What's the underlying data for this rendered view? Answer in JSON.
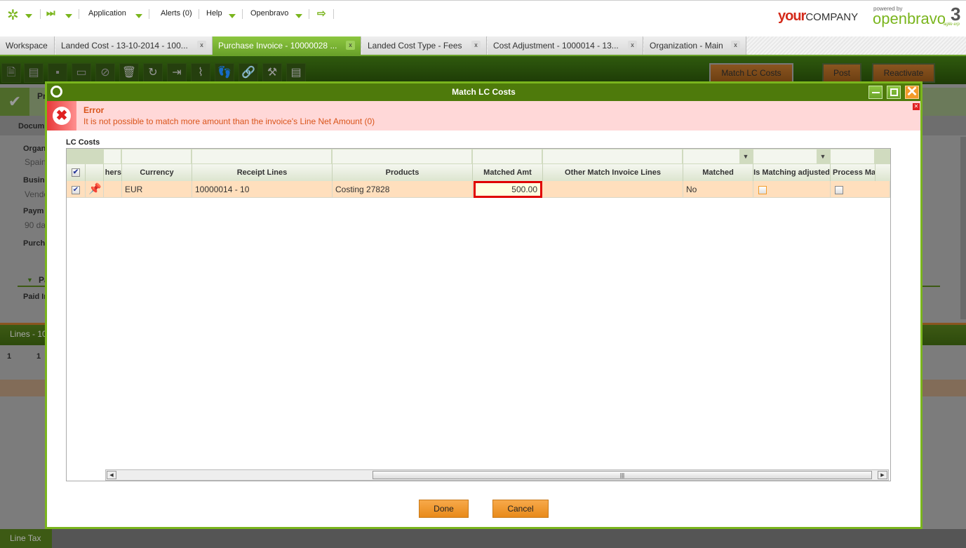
{
  "topnav": {
    "items": [
      "Application",
      "Alerts (0)",
      "Help",
      "Openbravo"
    ],
    "logo_your": "your",
    "logo_company": "COMPANY",
    "powered_by": "powered by",
    "brand": "openbravo",
    "brand_tag": "agile erp"
  },
  "tabs": [
    {
      "label": "Workspace",
      "closable": false
    },
    {
      "label": "Landed Cost - 13-10-2014 - 100...",
      "closable": true
    },
    {
      "label": "Purchase Invoice - 10000028 ...",
      "closable": true,
      "active": true
    },
    {
      "label": "Landed Cost Type - Fees",
      "closable": true
    },
    {
      "label": "Cost Adjustment - 1000014 - 13...",
      "closable": true
    },
    {
      "label": "Organization - Main",
      "closable": true
    }
  ],
  "toolbar": {
    "match_lc_costs": "Match LC Costs",
    "post": "Post",
    "reactivate": "Reactivate"
  },
  "background": {
    "status_short": "Pr",
    "section": "Docum",
    "fields": [
      {
        "label": "Organ",
        "value": "Spain"
      },
      {
        "label": "Busin",
        "value": "Vendo"
      },
      {
        "label": "Paym",
        "value": "90 da"
      },
      {
        "label": "Purch",
        "value": ""
      }
    ],
    "group": "Pa",
    "paid_label": "Paid In",
    "lines_tab": "Lines - 10",
    "line_tax_tab": "Line Tax",
    "grid_counts": [
      "1",
      "1"
    ]
  },
  "modal": {
    "title": "Match LC Costs",
    "error": {
      "title": "Error",
      "message": "It is not possible to match more amount than the invoice's Line Net Amount (0)"
    },
    "section_label": "LC Costs",
    "columns": [
      "hers",
      "Currency",
      "Receipt Lines",
      "Products",
      "Matched Amt",
      "Other Match Invoice Lines",
      "Matched",
      "Is Matching adjusted",
      "Process Mat"
    ],
    "rows": [
      {
        "selected": true,
        "currency": "EUR",
        "receipt_line": "10000014 - 10",
        "product": "Costing 27828",
        "matched_amt": "500.00",
        "other_lines": "",
        "matched": "No",
        "is_matching_adjusted": false,
        "process_matching": false
      }
    ],
    "done": "Done",
    "cancel": "Cancel"
  }
}
